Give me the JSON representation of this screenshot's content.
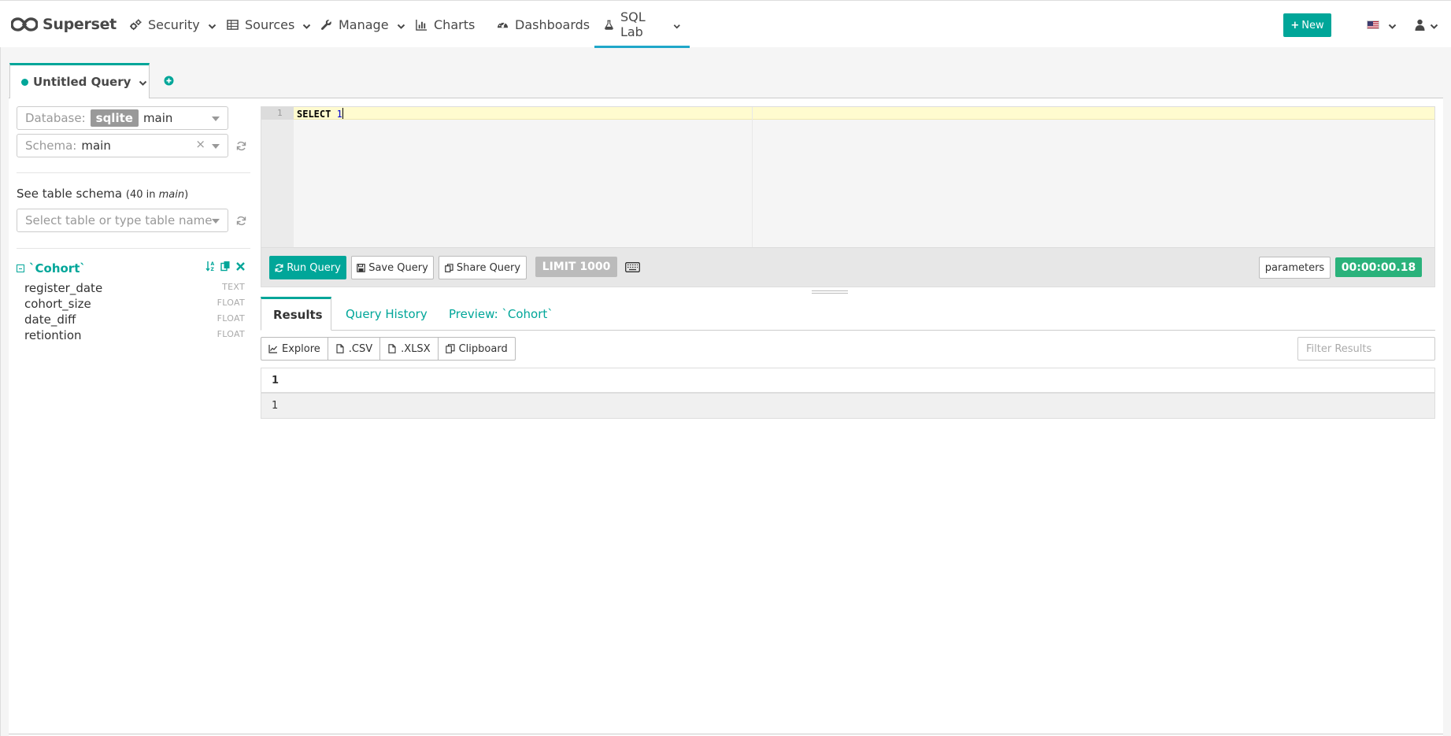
{
  "brand": {
    "name": "Superset"
  },
  "nav": {
    "items": [
      {
        "label": "Security"
      },
      {
        "label": "Sources"
      },
      {
        "label": "Manage"
      },
      {
        "label": "Charts"
      },
      {
        "label": "Dashboards"
      },
      {
        "label": "SQL Lab"
      }
    ],
    "new_label": "New"
  },
  "tabs": {
    "query_tab_label": "Untitled Query"
  },
  "sidebar": {
    "database_placeholder": "Database:",
    "database_tag": "sqlite",
    "database_value": "main",
    "schema_placeholder": "Schema:",
    "schema_value": "main",
    "schema_clear": "×",
    "see_schema_label": "See table schema",
    "see_schema_count_prefix": "(40 in ",
    "see_schema_count_schema": "main",
    "see_schema_count_suffix": ")",
    "table_select_placeholder": "Select table or type table name",
    "table_name": "`Cohort`",
    "columns": [
      {
        "name": "register_date",
        "type": "TEXT"
      },
      {
        "name": "cohort_size",
        "type": "FLOAT"
      },
      {
        "name": "date_diff",
        "type": "FLOAT"
      },
      {
        "name": "retiontion",
        "type": "FLOAT"
      }
    ]
  },
  "editor": {
    "line_number": "1",
    "code_keyword": "SELECT",
    "code_value": "1"
  },
  "toolbar": {
    "run_label": "Run Query",
    "save_label": "Save Query",
    "share_label": "Share Query",
    "limit_label": "LIMIT 1000",
    "parameters_label": "parameters",
    "timer": "00:00:00.18"
  },
  "results": {
    "tabs": [
      {
        "label": "Results"
      },
      {
        "label": "Query History"
      },
      {
        "label": "Preview: `Cohort`"
      }
    ],
    "export": {
      "explore": "Explore",
      "csv": ".CSV",
      "xlsx": ".XLSX",
      "clipboard": "Clipboard"
    },
    "filter_placeholder": "Filter Results",
    "columns": [
      "1"
    ],
    "rows": [
      [
        "1"
      ]
    ]
  },
  "colors": {
    "accent": "#00a699",
    "nav_active": "#20a7c9",
    "timer_bg": "#2ab27b"
  }
}
